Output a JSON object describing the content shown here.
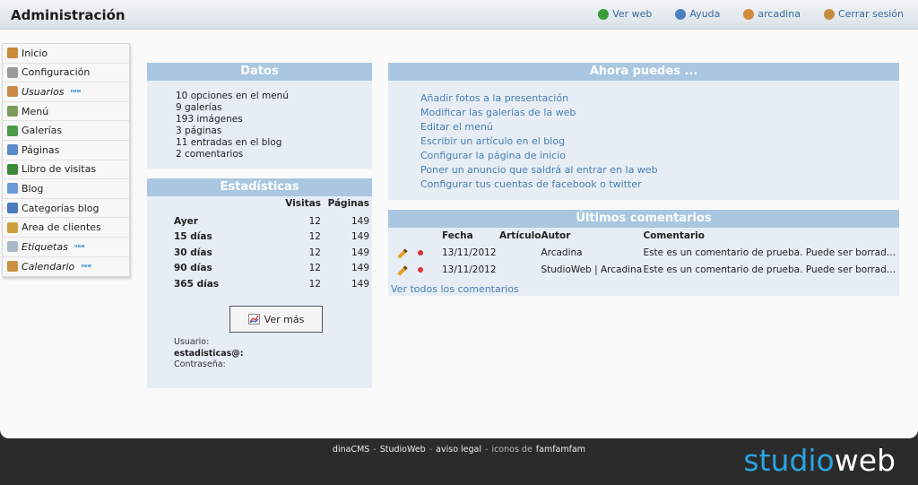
{
  "header": {
    "title": "Administración",
    "links": [
      {
        "label": "Ver web",
        "icon": "globe-icon",
        "color": "#3a9a3a"
      },
      {
        "label": "Ayuda",
        "icon": "help-icon",
        "color": "#4a7fc0"
      },
      {
        "label": "arcadina",
        "icon": "user-icon",
        "color": "#d08a3a"
      },
      {
        "label": "Cerrar sesión",
        "icon": "building-icon",
        "color": "#c88b3a"
      }
    ]
  },
  "sidebar": {
    "items": [
      {
        "label": "Inicio",
        "icon": "home-icon",
        "color": "#c8893a",
        "italic": false,
        "badge": ""
      },
      {
        "label": "Configuración",
        "icon": "gear-icon",
        "color": "#9a9a9a",
        "italic": false,
        "badge": ""
      },
      {
        "label": "Usuarios",
        "icon": "user-icon",
        "color": "#c98a4a",
        "italic": true,
        "badge": "new"
      },
      {
        "label": "Menú",
        "icon": "menu-icon",
        "color": "#7a9a5a",
        "italic": false,
        "badge": ""
      },
      {
        "label": "Galerías",
        "icon": "gallery-icon",
        "color": "#4a9a4a",
        "italic": false,
        "badge": ""
      },
      {
        "label": "Páginas",
        "icon": "page-icon",
        "color": "#5a8ac8",
        "italic": false,
        "badge": ""
      },
      {
        "label": "Libro de visitas",
        "icon": "book-icon",
        "color": "#3a8a3a",
        "italic": false,
        "badge": ""
      },
      {
        "label": "Blog",
        "icon": "blog-icon",
        "color": "#6a9ad8",
        "italic": false,
        "badge": ""
      },
      {
        "label": "Categorías blog",
        "icon": "folder-icon",
        "color": "#4a7ab8",
        "italic": false,
        "badge": ""
      },
      {
        "label": "Area de clientes",
        "icon": "clients-icon",
        "color": "#d0a040",
        "italic": false,
        "badge": ""
      },
      {
        "label": "Etiquetas",
        "icon": "tag-icon",
        "color": "#a8b8c8",
        "italic": true,
        "badge": "new"
      },
      {
        "label": "Calendario",
        "icon": "calendar-icon",
        "color": "#c89040",
        "italic": true,
        "badge": "new"
      }
    ]
  },
  "datos": {
    "title": "Datos",
    "lines": [
      "10 opciones en el menú",
      "9 galerías",
      "193 imágenes",
      "3 páginas",
      "11 entradas en el blog",
      "2 comentarios"
    ]
  },
  "stats": {
    "title": "Estadísticas",
    "headers": [
      "",
      "Visitas",
      "Páginas"
    ],
    "rows": [
      [
        "Ayer",
        "12",
        "149"
      ],
      [
        "15 días",
        "12",
        "149"
      ],
      [
        "30 días",
        "12",
        "149"
      ],
      [
        "90 días",
        "12",
        "149"
      ],
      [
        "365 días",
        "12",
        "149"
      ]
    ],
    "button_label": "Ver más",
    "user_label": "Usuario:",
    "user_value": "estadisticas@:",
    "pass_label": "Contraseña:"
  },
  "ahora": {
    "title": "Ahora puedes ...",
    "links": [
      "Añadir fotos a la presentación",
      "Modificar las galerías de la web",
      "Editar el menú",
      "Escribir un artículo en el blog",
      "Configurar la página de inicio",
      "Poner un anuncio que saldrá al entrar en la web",
      "Configurar tus cuentas de facebook o twitter"
    ]
  },
  "comentarios": {
    "title": "Últimos comentarios",
    "headers": [
      "",
      "",
      "Fecha",
      "Artículo",
      "Autor",
      "Comentario"
    ],
    "rows": [
      [
        "13/11/2012",
        "",
        "Arcadina",
        "Este es un comentario de prueba. Puede ser borrado..."
      ],
      [
        "13/11/2012",
        "",
        "StudioWeb | Arcadina",
        "Este es un comentario de prueba. Puede ser borrado..."
      ]
    ],
    "ver_todos": "Ver todos los comentarios"
  },
  "footer": {
    "items": [
      "dinaCMS",
      "StudioWeb",
      "aviso legal"
    ],
    "icons_text": "iconos de",
    "icons_link": "famfamfam",
    "separator": "-",
    "brand_a": "studio",
    "brand_b": "web"
  }
}
